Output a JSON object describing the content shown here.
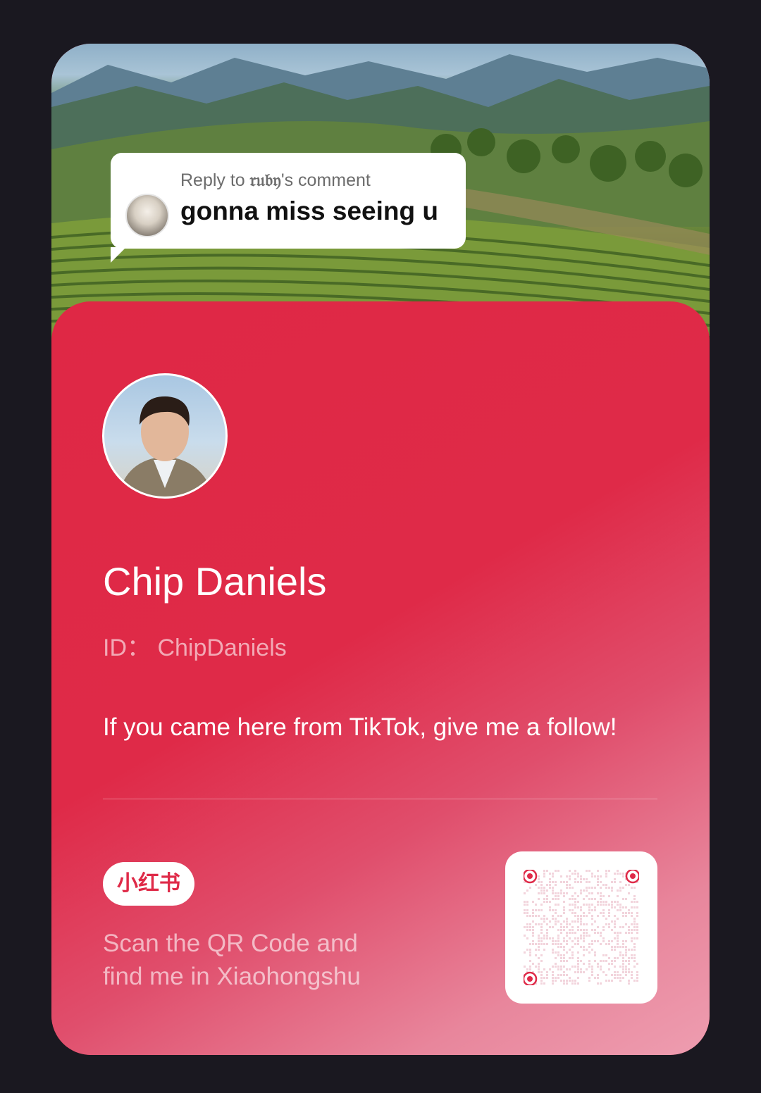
{
  "reply": {
    "prefix": "Reply to ",
    "username": "𝔯𝔲𝔟𝔶",
    "suffix": "'s comment",
    "comment": "gonna miss seeing u"
  },
  "profile": {
    "name": "Chip Daniels",
    "id_label": "ID：",
    "id_value": "ChipDaniels",
    "bio": "If you came here from TikTok, give me a follow!"
  },
  "footer": {
    "brand": "小红书",
    "scan_line1": "Scan the QR Code and",
    "scan_line2": "find me in Xiaohongshu"
  },
  "colors": {
    "brand_red": "#df2a48",
    "page_bg": "#1a1820"
  },
  "icons": [
    "user-avatar-icon",
    "qr-code-icon"
  ]
}
